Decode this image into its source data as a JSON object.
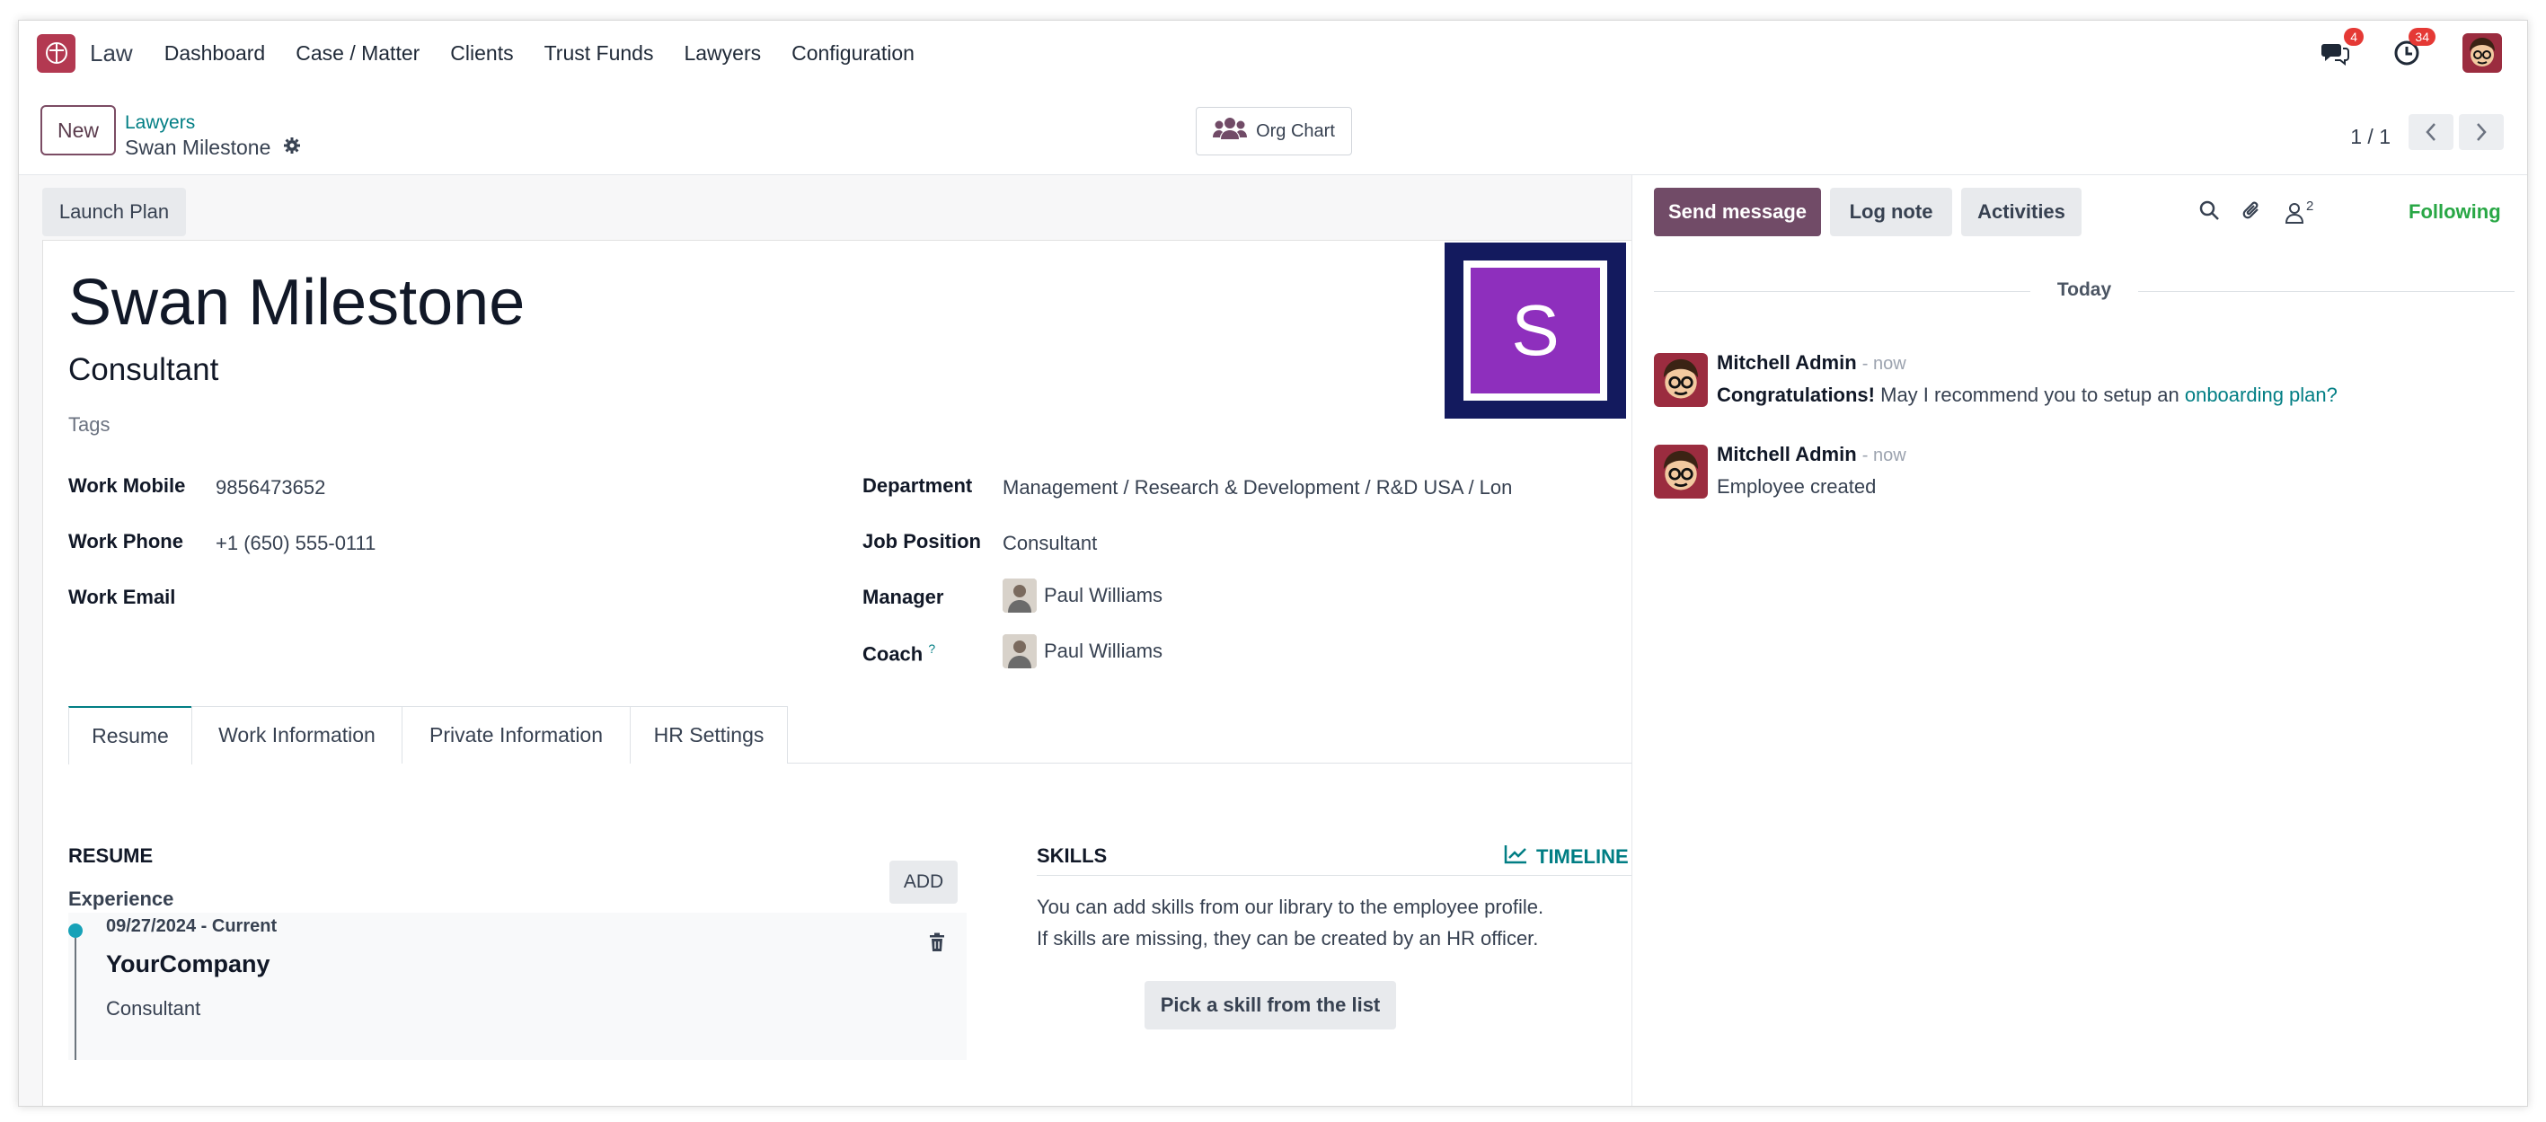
{
  "navbar": {
    "app_name": "Law",
    "menu": [
      "Dashboard",
      "Case / Matter",
      "Clients",
      "Trust Funds",
      "Lawyers",
      "Configuration"
    ],
    "messages_badge": "4",
    "activities_badge": "34",
    "icons": [
      "law-app-icon",
      "chat-icon",
      "clock-icon",
      "user-avatar"
    ]
  },
  "control": {
    "new_label": "New",
    "breadcrumb_parent": "Lawyers",
    "breadcrumb_current": "Swan Milestone",
    "org_chart_label": "Org Chart",
    "pager": "1 / 1"
  },
  "form": {
    "launch_plan_label": "Launch Plan",
    "name": "Swan Milestone",
    "job_title": "Consultant",
    "tags_placeholder": "Tags",
    "avatar_letter": "S",
    "colors": {
      "avatar_bg": "#8e2fbd",
      "avatar_frame": "#131a5e",
      "accent": "#017e84",
      "primary": "#714b67"
    },
    "left_fields": [
      {
        "label": "Work Mobile",
        "value": "9856473652"
      },
      {
        "label": "Work Phone",
        "value": "+1 (650) 555-0111"
      },
      {
        "label": "Work Email",
        "value": ""
      }
    ],
    "department": {
      "label": "Department",
      "value": "Management / Research & Development / R&D USA / Lon"
    },
    "job_position": {
      "label": "Job Position",
      "value": "Consultant"
    },
    "manager": {
      "label": "Manager",
      "value": "Paul Williams"
    },
    "coach": {
      "label": "Coach",
      "help": "?",
      "value": "Paul Williams"
    },
    "tabs": [
      "Resume",
      "Work Information",
      "Private Information",
      "HR Settings"
    ],
    "resume": {
      "title": "RESUME",
      "experience_label": "Experience",
      "add_label": "ADD",
      "entry": {
        "date": "09/27/2024 - Current",
        "company": "YourCompany",
        "role": "Consultant"
      }
    },
    "skills": {
      "title": "SKILLS",
      "timeline_label": "TIMELINE",
      "help_line1": "You can add skills from our library to the employee profile.",
      "help_line2": "If skills are missing, they can be created by an HR officer.",
      "pick_label": "Pick a skill from the list"
    }
  },
  "chatter": {
    "send_message": "Send message",
    "log_note": "Log note",
    "activities": "Activities",
    "followers_count": "2",
    "following": "Following",
    "today": "Today",
    "messages": [
      {
        "author": "Mitchell Admin",
        "time": "- now",
        "strong": "Congratulations!",
        "text": " May I recommend you to setup an ",
        "link": "onboarding plan?"
      },
      {
        "author": "Mitchell Admin",
        "time": "- now",
        "text": "Employee created"
      }
    ]
  }
}
